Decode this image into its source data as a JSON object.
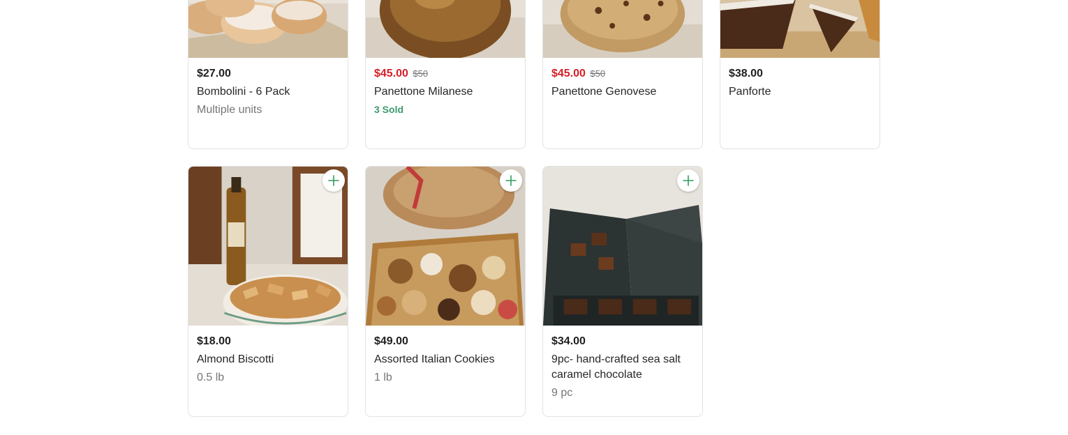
{
  "products": [
    {
      "price": "$27.00",
      "name": "Bombolini - 6 Pack",
      "subtitle": "Multiple units",
      "image_icon": "bombolini-image"
    },
    {
      "price": "$45.00",
      "old_price": "$50",
      "name": "Panettone Milanese",
      "status": "3 Sold",
      "image_icon": "panettone-image"
    },
    {
      "price": "$45.00",
      "old_price": "$50",
      "name": "Panettone Genovese",
      "image_icon": "panettone-genovese-image"
    },
    {
      "price": "$38.00",
      "name": "Panforte",
      "image_icon": "panforte-image"
    },
    {
      "price": "$18.00",
      "name": "Almond Biscotti",
      "subtitle": "0.5 lb",
      "image_icon": "biscotti-image"
    },
    {
      "price": "$49.00",
      "name": "Assorted Italian Cookies",
      "subtitle": "1 lb",
      "image_icon": "cookies-image"
    },
    {
      "price": "$34.00",
      "name": "9pc- hand-crafted sea salt caramel chocolate",
      "subtitle": "9 pc",
      "image_icon": "chocolate-image"
    }
  ],
  "colors": {
    "sale_price": "#d61f26",
    "sold_badge": "#3b9a6b",
    "add_icon": "#2e9e5b"
  }
}
